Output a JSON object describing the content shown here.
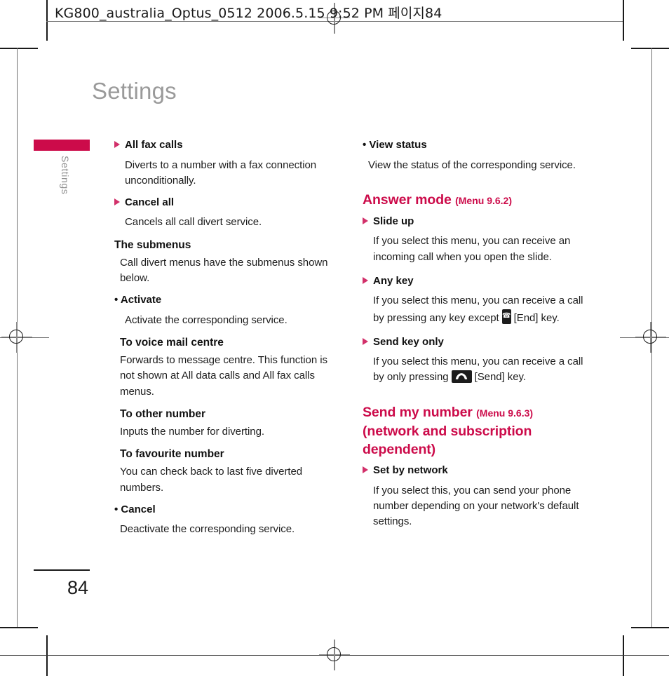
{
  "prepress": {
    "slug": "KG800_australia_Optus_0512  2006.5.15 9:52 PM  페이지84",
    "accent_color": "#cc0b4a",
    "bullet_color": "#d2306a",
    "title_color": "#9a9a9a"
  },
  "page": {
    "title": "Settings",
    "tab_label": "Settings",
    "number": "84"
  },
  "left_column": [
    {
      "type": "item-head",
      "bullet": "triangle",
      "text": "All fax calls"
    },
    {
      "type": "body",
      "text": "Diverts to a number with a fax connection unconditionally."
    },
    {
      "type": "item-head",
      "bullet": "triangle",
      "text": "Cancel all"
    },
    {
      "type": "body",
      "text": "Cancels all call divert service."
    },
    {
      "type": "plain-head",
      "text": "The submenus"
    },
    {
      "type": "body",
      "text": "Call divert menus have the submenus shown below."
    },
    {
      "type": "dot-head",
      "text": "• Activate"
    },
    {
      "type": "body",
      "text": "Activate the corresponding service."
    },
    {
      "type": "plain-head",
      "text": "To voice mail centre"
    },
    {
      "type": "body",
      "text": "Forwards to message centre. This function is not shown at All data calls and All fax calls menus."
    },
    {
      "type": "plain-head",
      "text": "To other number"
    },
    {
      "type": "body",
      "text": "Inputs the number for diverting."
    },
    {
      "type": "plain-head",
      "text": "To favourite number"
    },
    {
      "type": "body",
      "text": "You can check back to last five diverted numbers."
    },
    {
      "type": "dot-head",
      "text": "• Cancel"
    },
    {
      "type": "body",
      "text": "Deactivate the corresponding service."
    }
  ],
  "right_column": {
    "view_status": {
      "head": "• View status",
      "body": "View the status of the corresponding service."
    },
    "answer_mode": {
      "heading": "Answer mode",
      "menu_ref": "(Menu 9.6.2)",
      "items": [
        {
          "head": "Slide up",
          "body": "If you select this menu, you can receive an incoming call when you open the slide."
        },
        {
          "head": "Any key",
          "body_part1": "If you select this menu, you can receive a call by pressing any key except",
          "icon": "end-key-icon",
          "body_part2": "[End] key."
        },
        {
          "head": "Send key only",
          "body_part1": "If you select this menu, you can receive a call by only pressing",
          "icon": "send-key-icon",
          "body_part2": "[Send] key."
        }
      ]
    },
    "send_my_number": {
      "heading": "Send my number",
      "menu_ref": "(Menu 9.6.3)",
      "subheading": "(network and subscription dependent)",
      "items": [
        {
          "head": "Set by network",
          "body": "If you select this, you can send your phone number depending on your network's default settings."
        }
      ]
    }
  }
}
